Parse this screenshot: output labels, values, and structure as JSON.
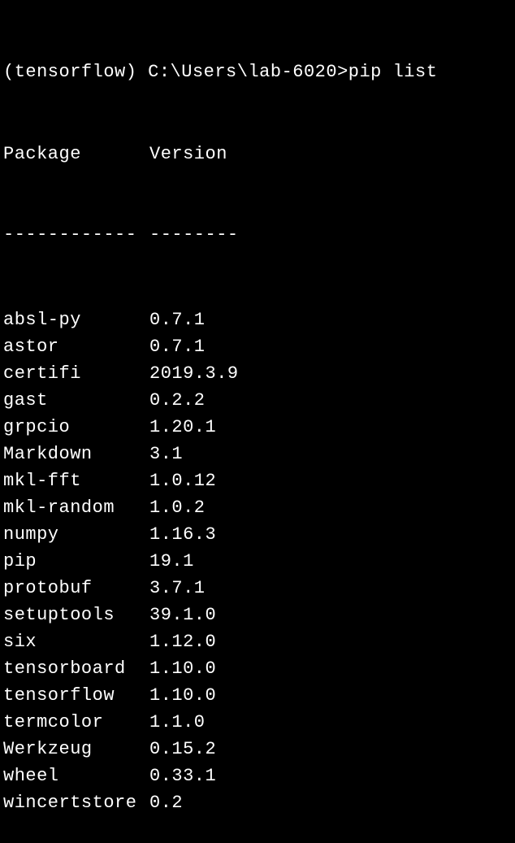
{
  "prompt": {
    "env": "(tensorflow)",
    "path": "C:\\Users\\lab-6020>",
    "command": "pip list"
  },
  "headers": {
    "package": "Package",
    "version": "Version"
  },
  "dividers": {
    "package": "------------",
    "version": "--------"
  },
  "packages": [
    {
      "name": "absl-py",
      "version": "0.7.1"
    },
    {
      "name": "astor",
      "version": "0.7.1"
    },
    {
      "name": "certifi",
      "version": "2019.3.9"
    },
    {
      "name": "gast",
      "version": "0.2.2"
    },
    {
      "name": "grpcio",
      "version": "1.20.1"
    },
    {
      "name": "Markdown",
      "version": "3.1"
    },
    {
      "name": "mkl-fft",
      "version": "1.0.12"
    },
    {
      "name": "mkl-random",
      "version": "1.0.2"
    },
    {
      "name": "numpy",
      "version": "1.16.3"
    },
    {
      "name": "pip",
      "version": "19.1"
    },
    {
      "name": "protobuf",
      "version": "3.7.1"
    },
    {
      "name": "setuptools",
      "version": "39.1.0"
    },
    {
      "name": "six",
      "version": "1.12.0"
    },
    {
      "name": "tensorboard",
      "version": "1.10.0"
    },
    {
      "name": "tensorflow",
      "version": "1.10.0"
    },
    {
      "name": "termcolor",
      "version": "1.1.0"
    },
    {
      "name": "Werkzeug",
      "version": "0.15.2"
    },
    {
      "name": "wheel",
      "version": "0.33.1"
    },
    {
      "name": "wincertstore",
      "version": "0.2"
    }
  ]
}
